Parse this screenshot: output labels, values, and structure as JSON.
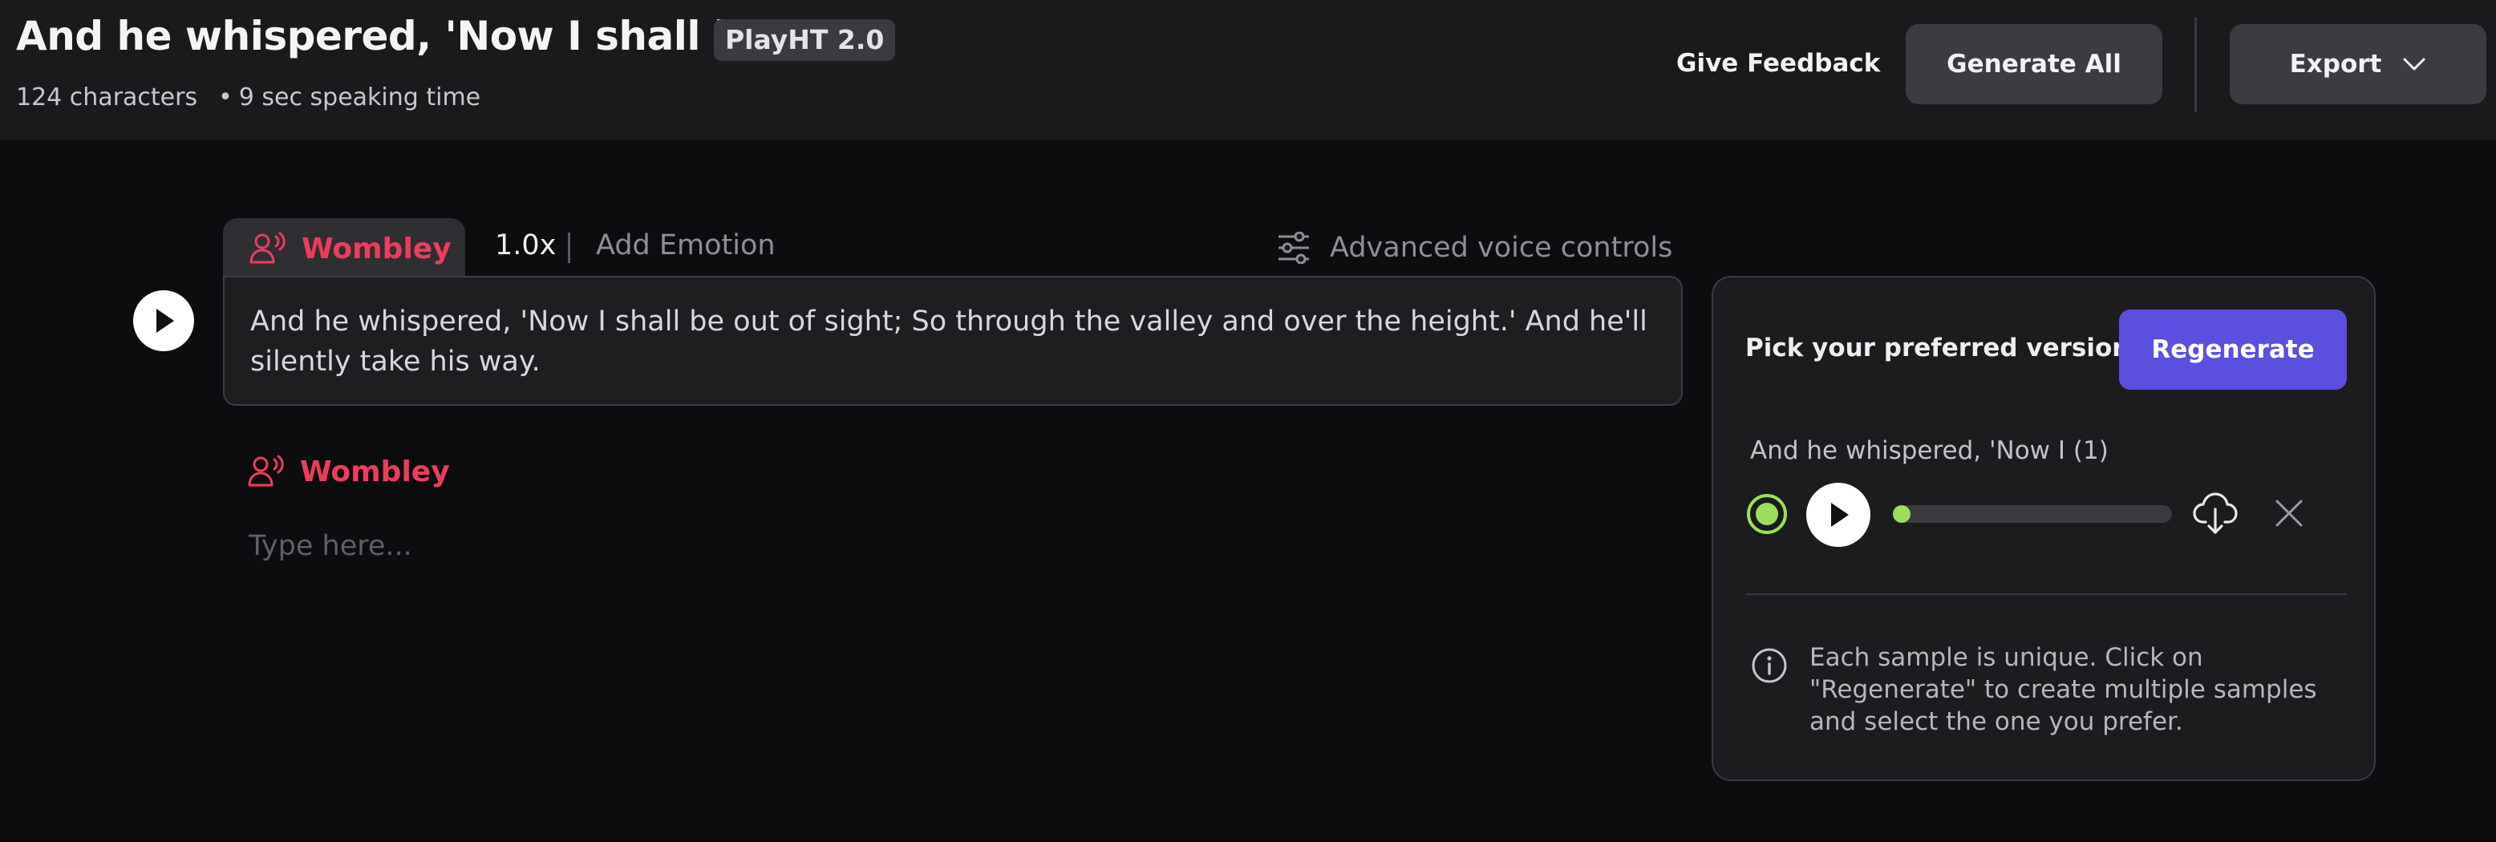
{
  "header": {
    "title": "And he whispered, 'Now I shall b...",
    "model_badge": "PlayHT 2.0",
    "char_count": "124 characters",
    "speaking_time": "9 sec speaking time",
    "feedback_label": "Give Feedback",
    "generate_all_label": "Generate All",
    "export_label": "Export"
  },
  "editor": {
    "voice_name": "Wombley",
    "speed": "1.0x",
    "add_emotion_label": "Add Emotion",
    "advanced_controls_label": "Advanced voice controls",
    "paragraph_text": "And he whispered, 'Now I shall be out of sight; So through the valley and over the height.' And he'll silently take his way.",
    "second_voice_name": "Wombley",
    "placeholder": "Type here..."
  },
  "panel": {
    "title": "Pick your preferred version",
    "regenerate_label": "Regenerate",
    "samples": [
      {
        "label": "And he whispered, 'Now I (1)",
        "selected": true,
        "progress": 0.0
      }
    ],
    "info_text": "Each sample is unique. Click on \"Regenerate\" to create multiple samples and select the one you prefer."
  },
  "colors": {
    "accent_voice": "#ec3d5a",
    "regenerate": "#5b4fe0",
    "selected_green": "#9be05a",
    "header_bg": "#1a1a1c",
    "page_bg": "#0d0d0f"
  }
}
